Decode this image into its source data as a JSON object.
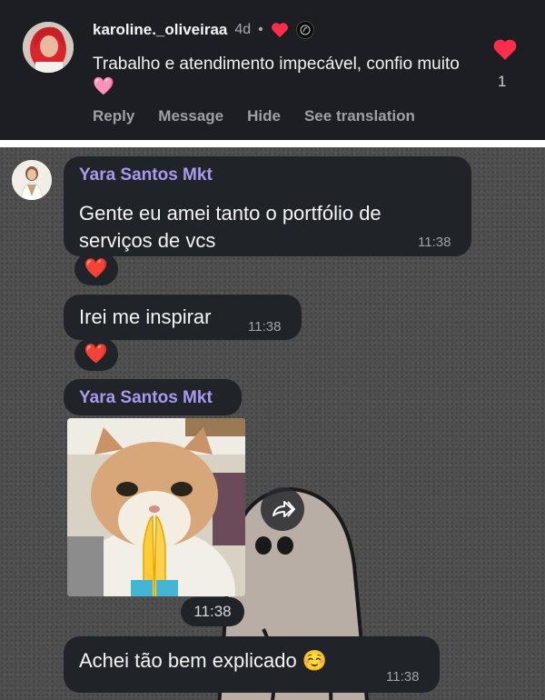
{
  "instagram_comment": {
    "username": "karoline._oliveiraa",
    "time": "4d",
    "separator": "•",
    "text": "Trabalho e atendimento impecável, confio muito 🩷",
    "actions": {
      "reply": "Reply",
      "message": "Message",
      "hide": "Hide",
      "translate": "See translation"
    },
    "like_count": "1",
    "heart_color": "#ff2d4a"
  },
  "telegram_chat": {
    "messages": [
      {
        "sender": "Yara Santos Mkt",
        "text": "Gente eu amei tanto o portfólio de serviços de vcs",
        "time": "11:38",
        "reaction": "❤️"
      },
      {
        "text": "Irei me inspirar",
        "time": "11:38",
        "reaction": "❤️"
      },
      {
        "sender": "Yara Santos Mkt",
        "type": "sticker",
        "time": "11:38"
      },
      {
        "text": "Achei tão bem explicado ☺️",
        "time": "11:38"
      }
    ],
    "sender_color": "#a99af0",
    "bubble_color": "#202327"
  }
}
